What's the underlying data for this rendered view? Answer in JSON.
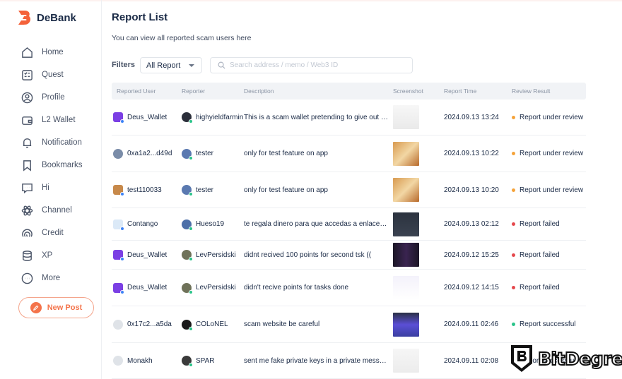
{
  "app": {
    "name": "DeBank",
    "brand_color": "#f4734a"
  },
  "sidebar": {
    "items": [
      {
        "label": "Home",
        "icon": "home-icon"
      },
      {
        "label": "Quest",
        "icon": "quest-checklist-icon"
      },
      {
        "label": "Profile",
        "icon": "profile-icon"
      },
      {
        "label": "L2 Wallet",
        "icon": "wallet-icon"
      },
      {
        "label": "Notification",
        "icon": "bell-icon"
      },
      {
        "label": "Bookmarks",
        "icon": "bookmark-icon"
      },
      {
        "label": "Hi",
        "icon": "chat-bubble-icon"
      },
      {
        "label": "Channel",
        "icon": "atom-icon"
      },
      {
        "label": "Credit",
        "icon": "gauge-icon"
      },
      {
        "label": "XP",
        "icon": "database-icon"
      },
      {
        "label": "More",
        "icon": "more-circle-icon"
      }
    ],
    "new_post_label": "New Post"
  },
  "page": {
    "title": "Report List",
    "subtitle": "You can view all reported scam users here",
    "filters_label": "Filters",
    "filter_selected": "All Report",
    "search_placeholder": "Search address / memo / Web3 ID"
  },
  "table": {
    "headers": [
      "Reported User",
      "Reporter",
      "Description",
      "Screenshot",
      "Report Time",
      "Review Result"
    ],
    "rows": [
      {
        "reported_user": "Deus_Wallet",
        "reporter": "highyieldfarmin",
        "description": "This is a scam wallet pretending to give out rewa...",
        "report_time": "2024.09.13 13:24",
        "result": "Report under review",
        "status": "review"
      },
      {
        "reported_user": "0xa1a2...d49d",
        "reporter": "tester",
        "description": "only for test feature on app",
        "report_time": "2024.09.13 10:22",
        "result": "Report under review",
        "status": "review"
      },
      {
        "reported_user": "test110033",
        "reporter": "tester",
        "description": "only for test feature on app",
        "report_time": "2024.09.13 10:20",
        "result": "Report under review",
        "status": "review"
      },
      {
        "reported_user": "Contango",
        "reporter": "Hueso19",
        "description": "te regala dinero para que accedas a enlaces pro...",
        "report_time": "2024.09.13 02:12",
        "result": "Report failed",
        "status": "failed"
      },
      {
        "reported_user": "Deus_Wallet",
        "reporter": "LevPersidski",
        "description": "didnt recived 100 points for second tsk ((",
        "report_time": "2024.09.12 15:25",
        "result": "Report failed",
        "status": "failed"
      },
      {
        "reported_user": "Deus_Wallet",
        "reporter": "LevPersidski",
        "description": "didn't recive points for tasks done",
        "report_time": "2024.09.12 14:15",
        "result": "Report failed",
        "status": "failed"
      },
      {
        "reported_user": "0x17c2...a5da",
        "reporter": "COLoNEL",
        "description": "scam website be careful",
        "report_time": "2024.09.11 02:46",
        "result": "Report successful",
        "status": "success"
      },
      {
        "reported_user": "Monakh",
        "reporter": "SPAR",
        "description": "sent me fake private keys in a private message a...",
        "report_time": "2024.09.11 02:08",
        "result": "Report successful",
        "status": "success"
      }
    ]
  },
  "status_colors": {
    "review": "#f5a33a",
    "failed": "#e5484d",
    "success": "#2bc48a"
  },
  "watermark": {
    "text": "BitDegree"
  }
}
